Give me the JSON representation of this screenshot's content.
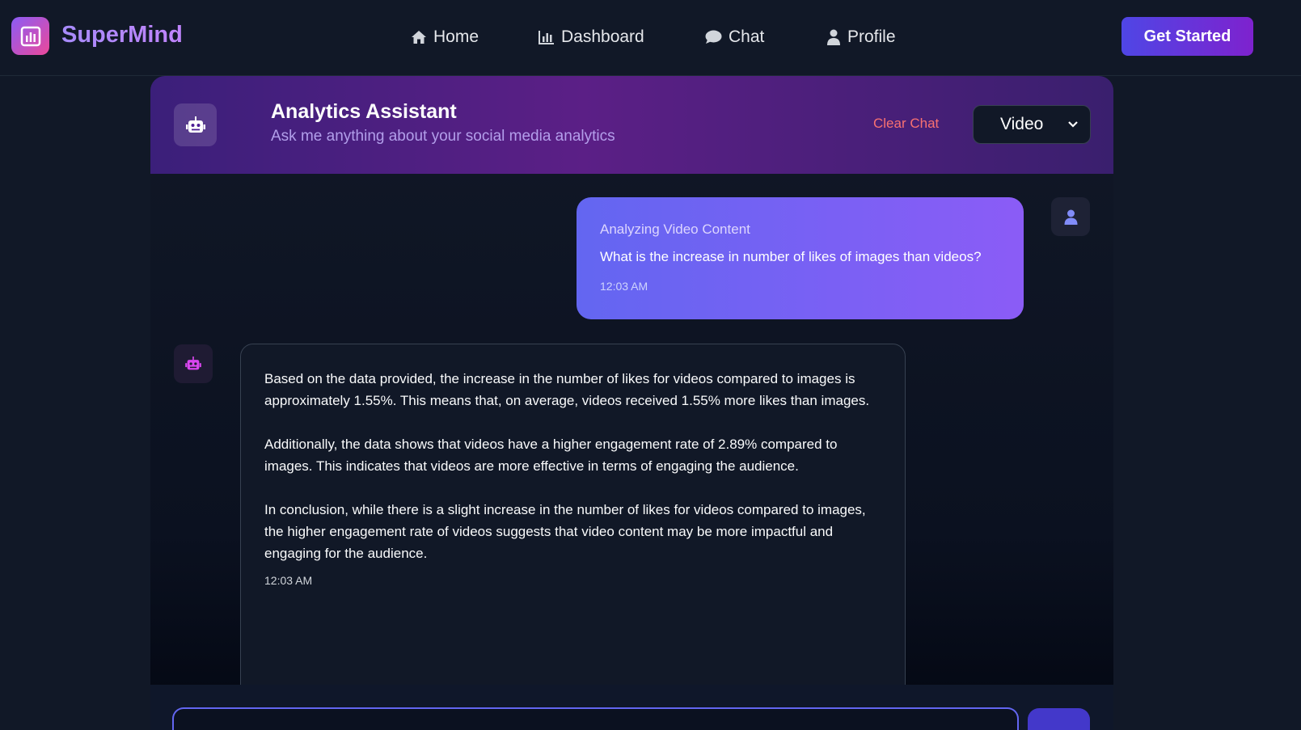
{
  "app": {
    "brand": "SuperMind"
  },
  "nav": {
    "items": [
      {
        "label": "Home",
        "icon": "home-icon"
      },
      {
        "label": "Dashboard",
        "icon": "bar-chart-icon"
      },
      {
        "label": "Chat",
        "icon": "chat-bubble-icon"
      },
      {
        "label": "Profile",
        "icon": "user-icon"
      }
    ],
    "cta_label": "Get Started"
  },
  "chat": {
    "title": "Analytics Assistant",
    "subtitle": "Ask me anything about your social media analytics",
    "clear_label": "Clear Chat",
    "content_type": "Video",
    "messages": [
      {
        "role": "user",
        "label": "Analyzing Video Content",
        "text": "What is the increase in number of likes of images than videos?",
        "time": "12:03 AM"
      },
      {
        "role": "assistant",
        "paragraphs": [
          "Based on the data provided, the increase in the number of likes for videos compared to images is approximately 1.55%. This means that, on average, videos received 1.55% more likes than images.",
          "Additionally, the data shows that videos have a higher engagement rate of 2.89% compared to images. This indicates that videos are more effective in terms of engaging the audience.",
          "In conclusion, while there is a slight increase in the number of likes for videos compared to images, the higher engagement rate of videos suggests that video content may be more impactful and engaging for the audience."
        ],
        "time": "12:03 AM"
      }
    ],
    "input": {
      "value": "",
      "placeholder": ""
    }
  },
  "colors": {
    "background": "#111827",
    "accent": "#6366f1",
    "brand_gradient_start": "#8b5cf6",
    "brand_gradient_end": "#ec4899",
    "clear_chat": "#f87171"
  }
}
